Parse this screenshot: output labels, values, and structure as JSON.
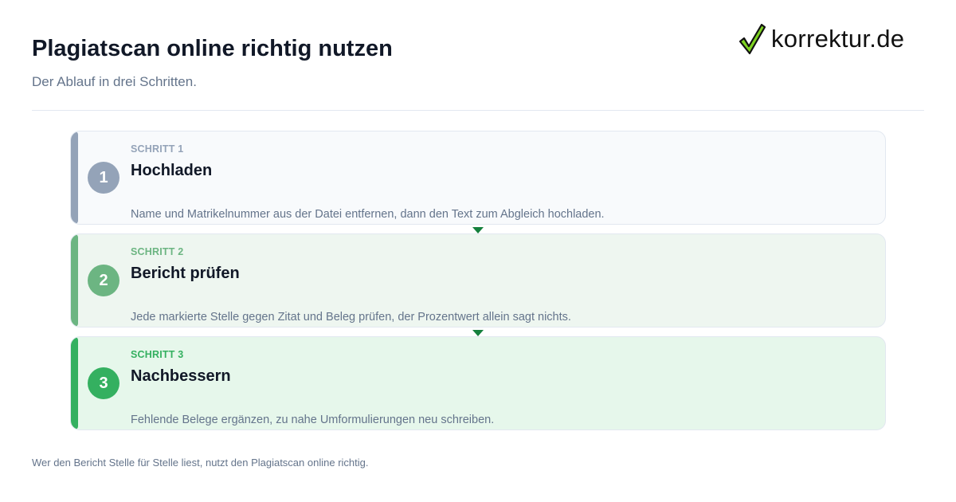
{
  "header": {
    "title": "Plagiatscan online richtig nutzen",
    "subtitle": "Der Ablauf in drei Schritten."
  },
  "logo": {
    "icon": "checkmark-icon",
    "text": "korrektur.de"
  },
  "steps": [
    {
      "number": "1",
      "label": "SCHRITT 1",
      "title": "Hochladen",
      "description": "Name und Matrikelnummer aus der Datei entfernen, dann den Text zum Abgleich hochladen.",
      "color": "#94a3b8"
    },
    {
      "number": "2",
      "label": "SCHRITT 2",
      "title": "Bericht prüfen",
      "description": "Jede markierte Stelle gegen Zitat und Beleg prüfen, der Prozentwert allein sagt nichts.",
      "color": "#6cb582"
    },
    {
      "number": "3",
      "label": "SCHRITT 3",
      "title": "Nachbessern",
      "description": "Fehlende Belege ergänzen, zu nahe Umformulierungen neu schreiben.",
      "color": "#34b060"
    }
  ],
  "connector_color": "#15803d",
  "footer": {
    "text": "Wer den Bericht Stelle für Stelle liest, nutzt den Plagiatscan online richtig."
  }
}
